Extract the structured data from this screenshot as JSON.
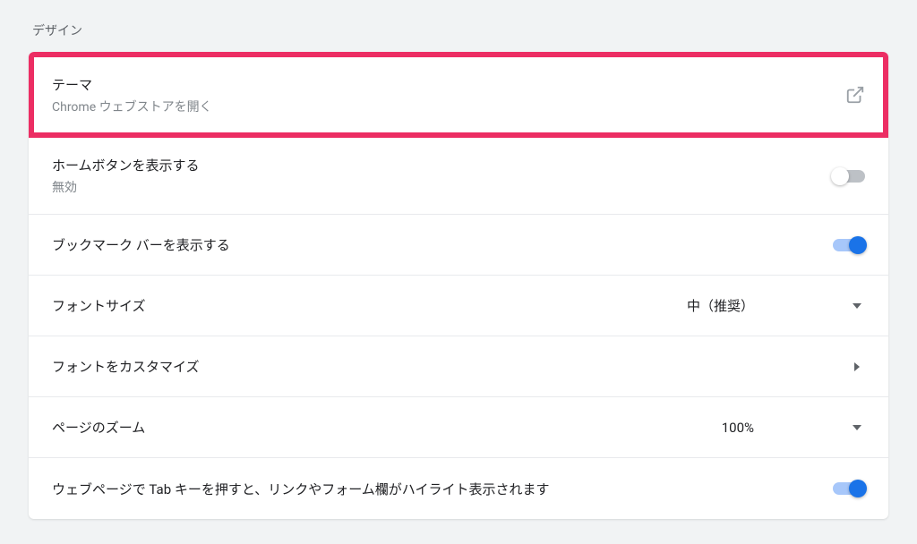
{
  "section": {
    "title": "デザイン"
  },
  "rows": {
    "theme": {
      "label": "テーマ",
      "sublabel": "Chrome ウェブストアを開く"
    },
    "homeButton": {
      "label": "ホームボタンを表示する",
      "sublabel": "無効"
    },
    "bookmarkBar": {
      "label": "ブックマーク バーを表示する"
    },
    "fontSize": {
      "label": "フォントサイズ",
      "value": "中（推奨）"
    },
    "customizeFont": {
      "label": "フォントをカスタマイズ"
    },
    "pageZoom": {
      "label": "ページのズーム",
      "value": "100%"
    },
    "tabHighlight": {
      "label": "ウェブページで Tab キーを押すと、リンクやフォーム欄がハイライト表示されます"
    }
  }
}
